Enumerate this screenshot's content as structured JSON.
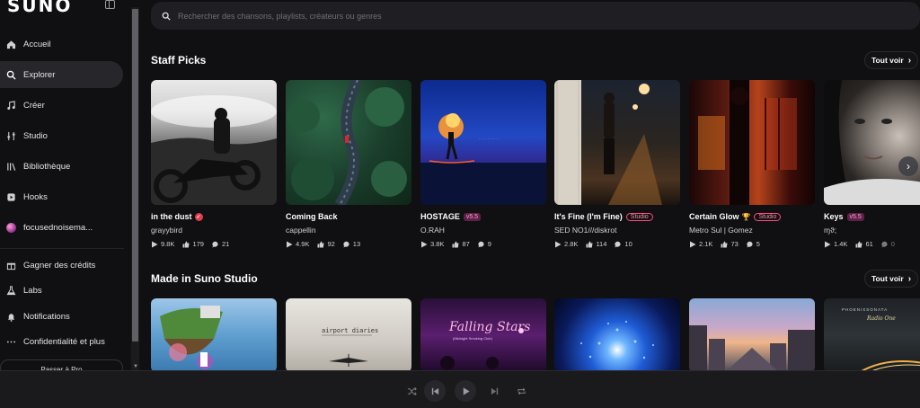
{
  "app": {
    "logo": "SUNO"
  },
  "sidebar": {
    "items": [
      {
        "label": "Accueil",
        "icon": "home-icon"
      },
      {
        "label": "Explorer",
        "icon": "search-icon",
        "active": true
      },
      {
        "label": "Créer",
        "icon": "music-note-icon"
      },
      {
        "label": "Studio",
        "icon": "studio-icon"
      },
      {
        "label": "Bibliothèque",
        "icon": "library-icon"
      },
      {
        "label": "Hooks",
        "icon": "hooks-icon"
      },
      {
        "label": "focusednoisema...",
        "icon": "avatar"
      }
    ],
    "secondary": [
      {
        "label": "Gagner des crédits",
        "icon": "gift-icon"
      },
      {
        "label": "Labs",
        "icon": "flask-icon"
      },
      {
        "label": "Notifications",
        "icon": "bell-icon"
      },
      {
        "label": "Confidentialité et plus",
        "icon": "more-icon"
      }
    ],
    "upgrade_label": "Passer à Pro"
  },
  "search": {
    "placeholder": "Rechercher des chansons, playlists, créateurs ou genres"
  },
  "staff_picks": {
    "title": "Staff Picks",
    "see_all": "Tout voir",
    "cards": [
      {
        "title": "in the dust",
        "artist": "grayybird",
        "plays": "9.8K",
        "likes": "179",
        "comments": "21",
        "verified": true,
        "cover": "motorcycle-bw"
      },
      {
        "title": "Coming Back",
        "artist": "cappellin",
        "plays": "4.9K",
        "likes": "92",
        "comments": "13",
        "cover": "forest-road"
      },
      {
        "title": "HOSTAGE",
        "badge": "v5.5",
        "artist": "O.RAH",
        "plays": "3.8K",
        "likes": "87",
        "comments": "9",
        "cover": "fire-night"
      },
      {
        "title": "It's Fine (I'm Fine)",
        "badge": "Studio",
        "artist": "SED NO1///diskrot",
        "plays": "2.8K",
        "likes": "114",
        "comments": "10",
        "cover": "rainy-street"
      },
      {
        "title": "Certain Glow",
        "badge": "Studio",
        "trophy": true,
        "artist": "Metro Sul | Gomez",
        "plays": "2.1K",
        "likes": "73",
        "comments": "5",
        "cover": "red-window"
      },
      {
        "title": "Keys",
        "badge": "v5.5",
        "artist": "ɱϑ;",
        "plays": "1.4K",
        "likes": "61",
        "comments": "0",
        "cover": "portrait"
      }
    ]
  },
  "studio_section": {
    "title": "Made in Suno Studio",
    "see_all": "Tout voir",
    "covers": [
      {
        "cover": "floating-island"
      },
      {
        "cover": "airport",
        "text": "airport diaries"
      },
      {
        "cover": "falling-stars",
        "text": "Falling Stars",
        "subtext": "(Midnight Smoking Club)"
      },
      {
        "cover": "blue-burst"
      },
      {
        "cover": "city-dusk"
      },
      {
        "cover": "night-road",
        "text": "PHOENIXSONATA",
        "subtext": "Radio One"
      }
    ]
  },
  "player": {
    "controls": [
      "shuffle-icon",
      "previous-icon",
      "play-icon",
      "next-icon",
      "repeat-icon"
    ]
  },
  "colors": {
    "accent": "#ff4d7d",
    "background": "#101012",
    "panel": "#1f1f23"
  }
}
